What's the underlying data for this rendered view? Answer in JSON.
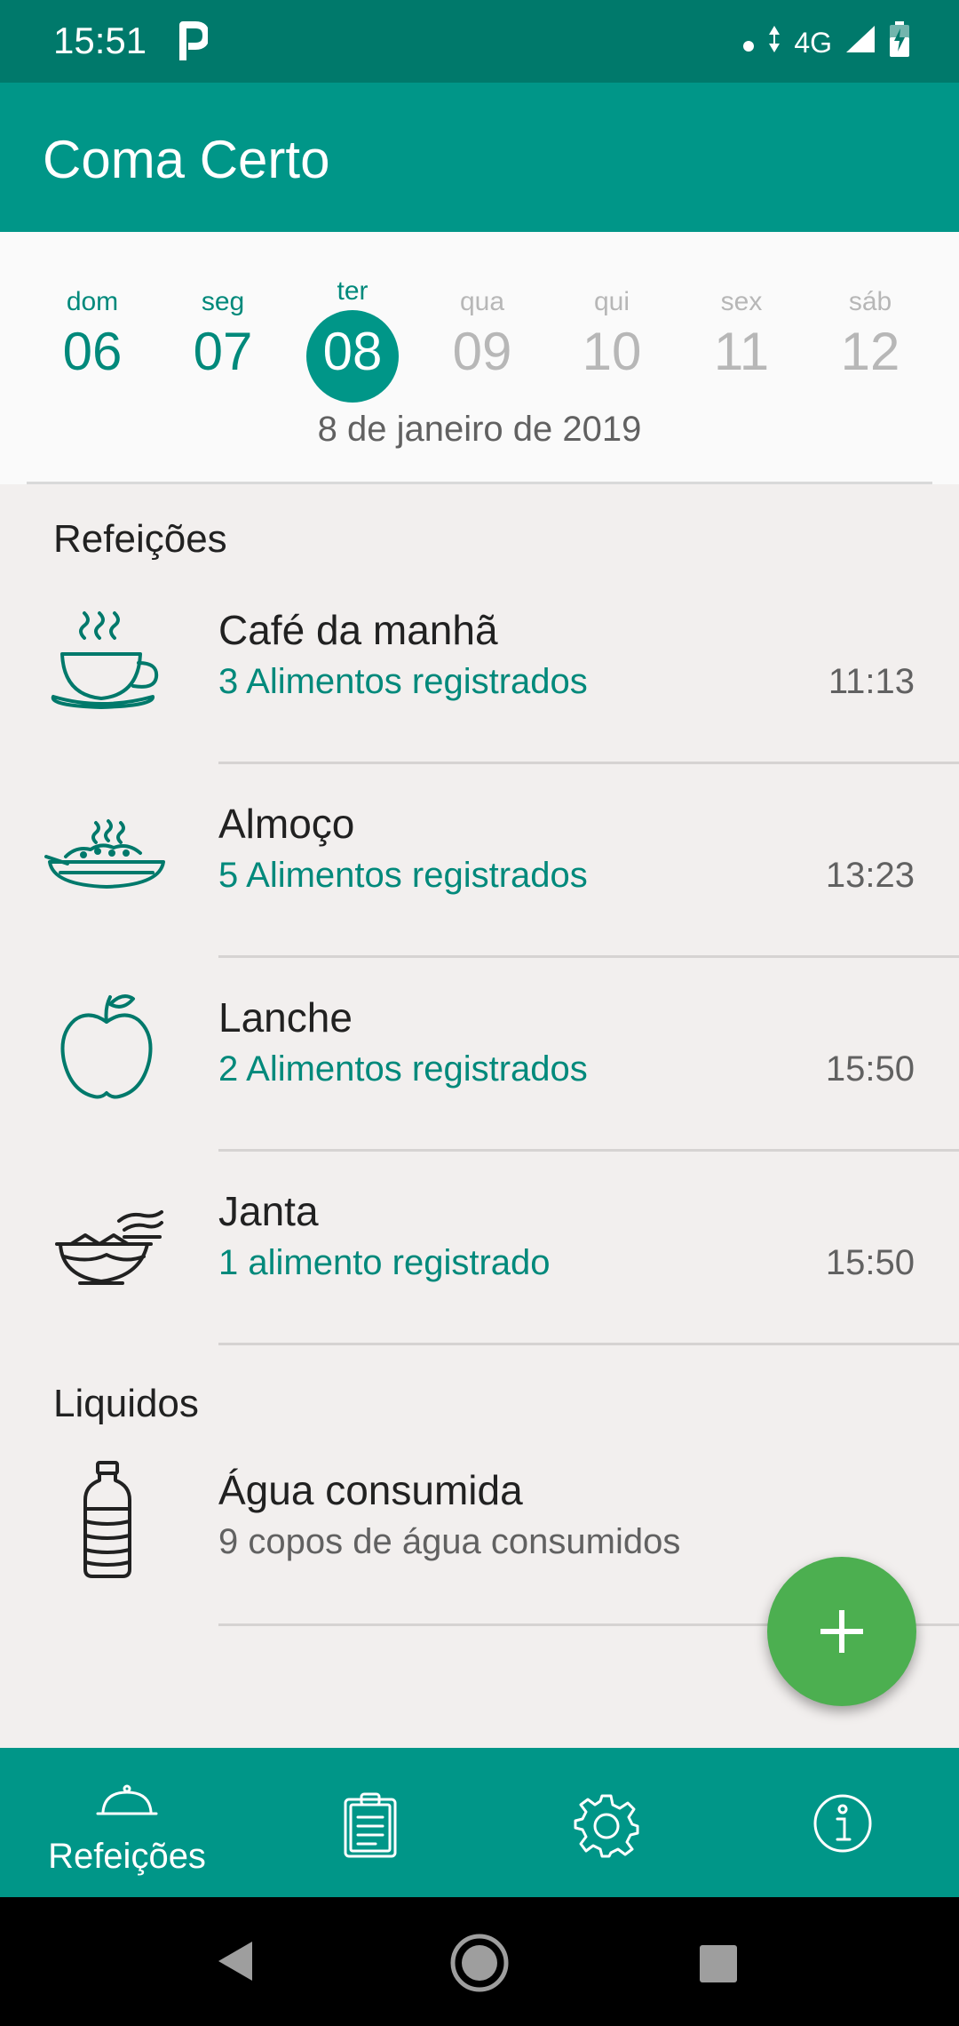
{
  "status_bar": {
    "time": "15:51",
    "network": "4G",
    "icons": [
      "parking-app-icon",
      "notification-dot-icon",
      "data-arrows-icon",
      "signal-icon",
      "battery-charging-icon"
    ]
  },
  "app_bar": {
    "title": "Coma Certo"
  },
  "date_strip": {
    "days": [
      {
        "name": "dom",
        "number": "06",
        "state": "past"
      },
      {
        "name": "seg",
        "number": "07",
        "state": "past"
      },
      {
        "name": "ter",
        "number": "08",
        "state": "selected"
      },
      {
        "name": "qua",
        "number": "09",
        "state": "future"
      },
      {
        "name": "qui",
        "number": "10",
        "state": "future"
      },
      {
        "name": "sex",
        "number": "11",
        "state": "future"
      },
      {
        "name": "sáb",
        "number": "12",
        "state": "future"
      }
    ],
    "selected_date": "8 de janeiro de 2019"
  },
  "meals": {
    "section_title": "Refeições",
    "items": [
      {
        "name": "Café da manhã",
        "summary": "3 Alimentos registrados",
        "time": "11:13",
        "icon": "coffee-cup-icon"
      },
      {
        "name": "Almoço",
        "summary": "5 Alimentos registrados",
        "time": "13:23",
        "icon": "plate-of-food-icon"
      },
      {
        "name": "Lanche",
        "summary": "2 Alimentos registrados",
        "time": "15:50",
        "icon": "apple-icon"
      },
      {
        "name": "Janta",
        "summary": "1 alimento registrado",
        "time": "15:50",
        "icon": "soup-bowl-icon"
      }
    ]
  },
  "liquids": {
    "section_title": "Liquidos",
    "items": [
      {
        "name": "Água consumida",
        "summary": "9 copos de água consumidos",
        "icon": "water-bottle-icon"
      }
    ]
  },
  "fab": {
    "icon": "plus-icon"
  },
  "bottom_nav": {
    "items": [
      {
        "label": "Refeições",
        "icon": "cloche-icon",
        "active": true
      },
      {
        "label": "",
        "icon": "clipboard-icon",
        "active": false
      },
      {
        "label": "",
        "icon": "gear-icon",
        "active": false
      },
      {
        "label": "",
        "icon": "info-icon",
        "active": false
      }
    ]
  },
  "system_nav": {
    "icons": [
      "back-icon",
      "home-icon",
      "recents-icon"
    ]
  },
  "colors": {
    "primary_dark": "#00796b",
    "primary": "#009688",
    "accent_text": "#00897b",
    "fab": "#4caf50",
    "background": "#f2efee"
  }
}
